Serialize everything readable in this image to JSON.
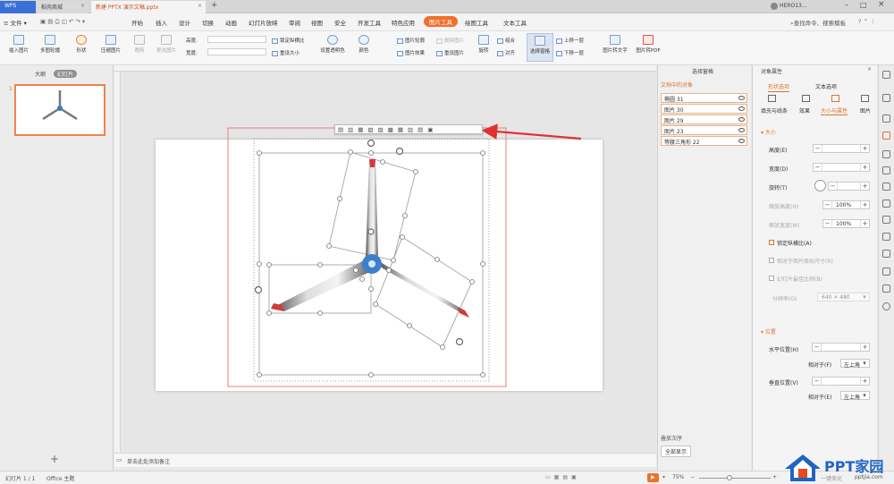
{
  "titlebar": {
    "tabs": [
      {
        "label": "WPS"
      },
      {
        "label": "稻壳商城"
      },
      {
        "label": "新建 PPTX 演示文稿.pptx"
      }
    ],
    "user": "HERO13..."
  },
  "menubar": {
    "file_label": "文件",
    "items": [
      "开始",
      "插入",
      "设计",
      "切换",
      "动画",
      "幻灯片放映",
      "审阅",
      "视图",
      "安全",
      "开发工具",
      "特色应用",
      "图片工具",
      "绘图工具",
      "文本工具"
    ],
    "active": "图片工具",
    "search_placeholder": "查找命令、搜索模板"
  },
  "ribbon": {
    "insert_picture": "插入图片",
    "multi_picture": "多图轮播",
    "shape": "形状",
    "compress": "压缩图片",
    "crop": "裁剪",
    "change_picture": "更改图片",
    "height_label": "高度:",
    "width_label": "宽度:",
    "lock_ratio": "锁定纵横比",
    "reset_size": "重设大小",
    "set_transparent": "设置透明色",
    "color": "颜色",
    "picture_outline": "图片轮廓",
    "picture_effect": "图片效果",
    "reset_picture": "重设图片",
    "delete_picture": "删除图片",
    "rotate": "旋转",
    "combine": "组合",
    "align": "对齐",
    "selection_pane": "选择窗格",
    "bring_forward": "上移一层",
    "send_backward": "下移一层",
    "pic_to_text": "图片转文字",
    "pic_to_pdf": "图片转PDF"
  },
  "leftpanel": {
    "tab_outline": "大纲",
    "tab_slides": "幻灯片",
    "slide_number": "1",
    "add_label": "+"
  },
  "selection_pane": {
    "title": "选择窗格",
    "objects_title": "文档中的对象",
    "objects": [
      "椭圆 31",
      "图片 30",
      "图片 29",
      "图片 23",
      "等腰三角形 22"
    ],
    "stack_order": "叠放次序",
    "show_all": "全部显示"
  },
  "properties_pane": {
    "title": "对象属性",
    "tab_shape": "形状选项",
    "tab_text": "文本选项",
    "sub_tabs": [
      "填充与线条",
      "效果",
      "大小与属性",
      "图片"
    ],
    "active_sub": "大小与属性",
    "size_section": "大小",
    "height": "高度(E)",
    "width": "宽度(D)",
    "rotation": "旋转(T)",
    "scale_height": "缩放高度(H)",
    "scale_height_value": "100%",
    "scale_width": "缩放宽度(W)",
    "scale_width_value": "100%",
    "lock_ratio": "锁定纵横比(A)",
    "relative_original": "相对于图片原始尺寸(R)",
    "best_scale": "幻灯片最佳比例(B)",
    "resolution": "分辨率(O)",
    "resolution_value": "640 × 480",
    "position_section": "位置",
    "horizontal": "水平位置(H)",
    "relative_to": "相对于(F)",
    "relative_value": "左上角",
    "vertical": "垂直位置(V)",
    "relative_to_v": "相对于(E)",
    "relative_value_v": "左上角"
  },
  "notes": {
    "placeholder": "单击此处添加备注"
  },
  "statusbar": {
    "slide_info": "幻灯片 1 / 1",
    "theme": "Office 主题",
    "zoom": "75%",
    "beautify": "一键美化"
  },
  "watermark": {
    "text": "PPT家园",
    "sub": "pptjia.com"
  },
  "colors": {
    "accent": "#f0702a",
    "arrow": "#e03030",
    "selection": "#e87e7e"
  }
}
